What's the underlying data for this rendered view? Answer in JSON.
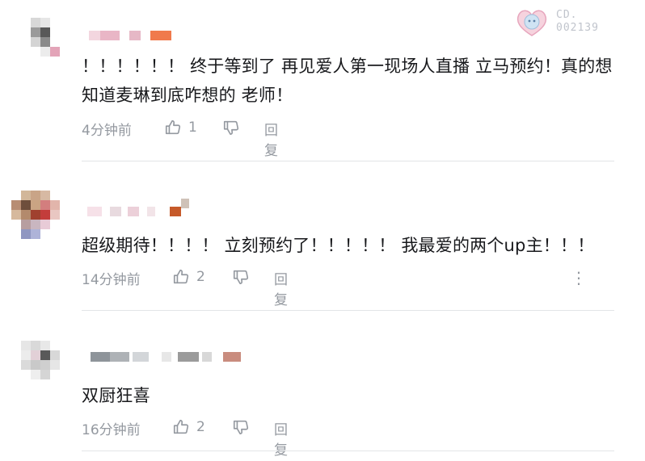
{
  "badge": {
    "line1": "CD.",
    "line2": "002139"
  },
  "colors": {
    "text": "#18191c",
    "meta": "#9499a0",
    "divider": "#e3e5e7"
  },
  "comments": [
    {
      "text": "！！！！！！ 终于等到了 再见爱人第一现场人直播 立马预约！真的想知道麦琳到底咋想的 老师！",
      "time": "4分钟前",
      "likes": "1",
      "reply": "回复"
    },
    {
      "text": "超级期待！！！！ 立刻预约了！！！！！ 我最爱的两个up主！！！",
      "time": "14分钟前",
      "likes": "2",
      "reply": "回复",
      "more": "⋮"
    },
    {
      "text": "双厨狂喜",
      "time": "16分钟前",
      "likes": "2",
      "reply": "回复"
    }
  ]
}
